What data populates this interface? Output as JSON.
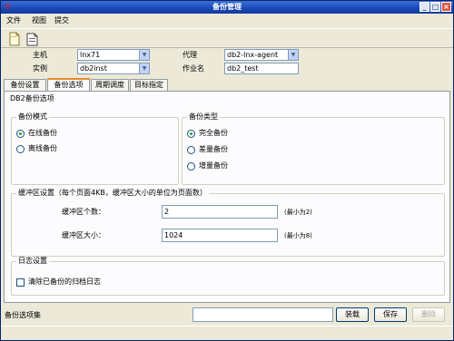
{
  "window": {
    "title": "备份管理",
    "app_icon": "ibm-icon"
  },
  "titlebar_controls": {
    "minimize": "_",
    "maximize": "□",
    "close": "×"
  },
  "menu": [
    "文件",
    "视图",
    "提交"
  ],
  "toolbar": {
    "new_icon": "new-document-icon",
    "open_icon": "open-document-icon"
  },
  "form": {
    "host_label": "主机",
    "host_value": "lnx71",
    "proxy_label": "代理",
    "proxy_value": "db2-lnx-agent",
    "instance_label": "实例",
    "instance_value": "db2inst",
    "job_label": "作业名",
    "job_value": "db2_test"
  },
  "tabs": [
    "备份设置",
    "备份选项",
    "周期调度",
    "目标指定"
  ],
  "active_tab": 1,
  "panel": {
    "title": "DB2备份选项",
    "mode": {
      "title": "备份模式",
      "options": [
        {
          "label": "在线备份",
          "selected": true
        },
        {
          "label": "离线备份",
          "selected": false
        }
      ]
    },
    "type": {
      "title": "备份类型",
      "options": [
        {
          "label": "完全备份",
          "selected": true
        },
        {
          "label": "差量备份",
          "selected": false
        },
        {
          "label": "增量备份",
          "selected": false
        }
      ]
    },
    "buffer": {
      "title": "缓冲区设置（每个页面4KB，缓冲区大小的单位为页面数）",
      "count_label": "缓冲区个数：",
      "count_value": "2",
      "count_hint": "(最小为2)",
      "size_label": "缓冲区大小：",
      "size_value": "1024",
      "size_hint": "(最小为8)"
    },
    "log": {
      "title": "日志设置",
      "clear_label": "清除已备份的归档日志",
      "clear_checked": false
    }
  },
  "status": {
    "label": "备份选项集",
    "text": ""
  },
  "buttons": {
    "load": "装载",
    "save": "保存",
    "delete": "删除"
  }
}
